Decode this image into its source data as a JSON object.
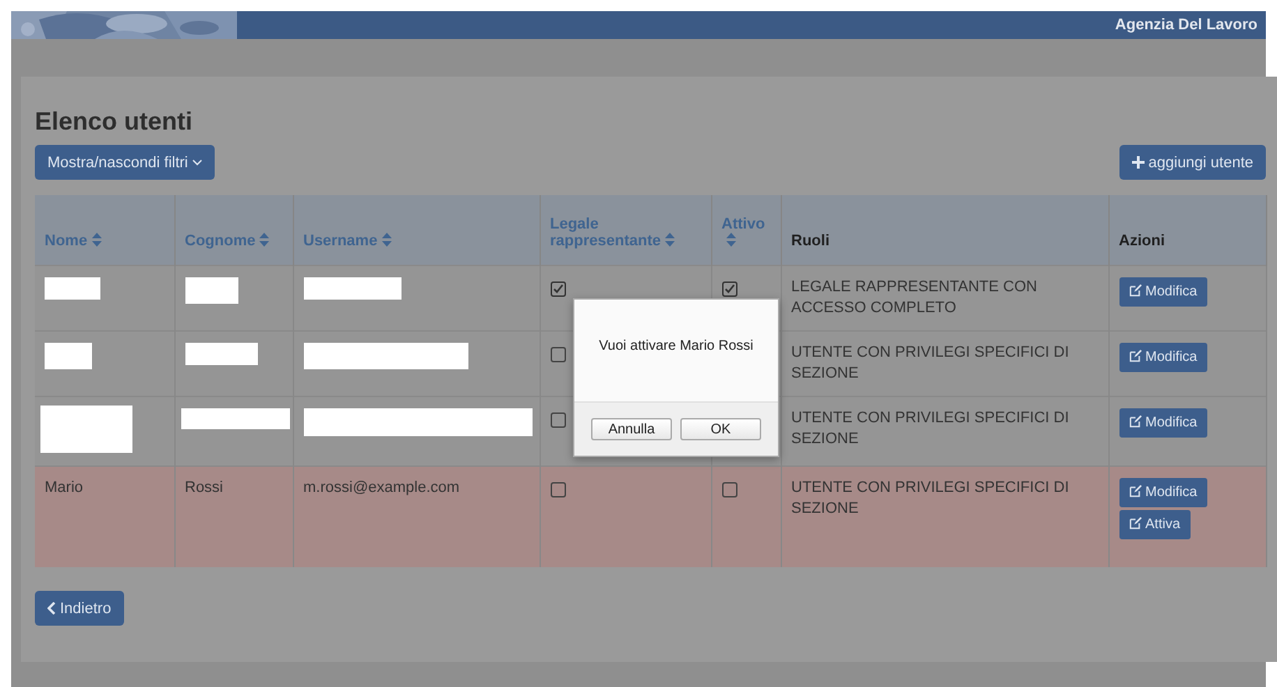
{
  "header": {
    "brand": "Agenzia Del Lavoro"
  },
  "page": {
    "title": "Elenco utenti",
    "filter_button": "Mostra/nascondi filtri",
    "add_button": "aggiungi utente",
    "back_button": "Indietro"
  },
  "table": {
    "columns": [
      {
        "label": "Nome",
        "sortable": true
      },
      {
        "label": "Cognome",
        "sortable": true
      },
      {
        "label": "Username",
        "sortable": true
      },
      {
        "label": "Legale rappresentante",
        "sortable": true
      },
      {
        "label": "Attivo",
        "sortable": true
      },
      {
        "label": "Ruoli",
        "sortable": false
      },
      {
        "label": "Azioni",
        "sortable": false
      }
    ],
    "rows": [
      {
        "highlighted": false,
        "nome": {
          "kind": "redacted"
        },
        "cognome": {
          "kind": "redacted"
        },
        "username": {
          "kind": "redacted"
        },
        "legale": true,
        "attivo": true,
        "ruoli": "LEGALE RAPPRESENTANTE CON ACCESSO COMPLETO",
        "actions": [
          "Modifica"
        ]
      },
      {
        "highlighted": false,
        "nome": {
          "kind": "redacted"
        },
        "cognome": {
          "kind": "redacted"
        },
        "username": {
          "kind": "redacted"
        },
        "legale": false,
        "ruoli": "UTENTE CON PRIVILEGI SPECIFICI DI SEZIONE",
        "actions": [
          "Modifica"
        ]
      },
      {
        "highlighted": false,
        "nome": {
          "kind": "redacted"
        },
        "cognome": {
          "kind": "redacted"
        },
        "username": {
          "kind": "redacted"
        },
        "legale": false,
        "ruoli": "UTENTE CON PRIVILEGI SPECIFICI DI SEZIONE",
        "actions": [
          "Modifica"
        ]
      },
      {
        "highlighted": true,
        "nome": {
          "kind": "text",
          "text": "Mario"
        },
        "cognome": {
          "kind": "text",
          "text": "Rossi"
        },
        "username": {
          "kind": "text",
          "text": "m.rossi@example.com"
        },
        "legale": false,
        "attivo": false,
        "ruoli": "UTENTE CON PRIVILEGI SPECIFICI DI SEZIONE",
        "actions": [
          "Modifica",
          "Attiva"
        ]
      }
    ]
  },
  "dialog": {
    "message": "Vuoi attivare Mario Rossi",
    "buttons": [
      "Annulla",
      "OK"
    ]
  }
}
